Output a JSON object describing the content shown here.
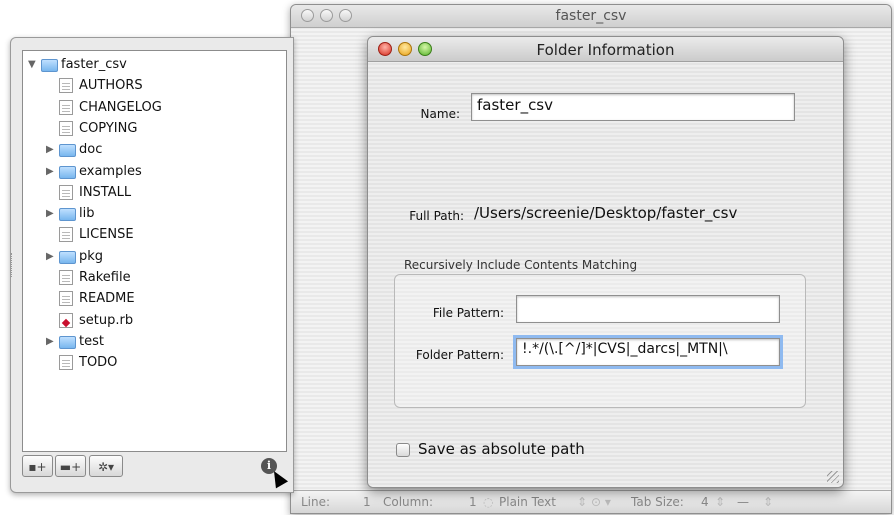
{
  "editor": {
    "title": "faster_csv",
    "status": {
      "line_label": "Line:",
      "line_value": "1",
      "column_label": "Column:",
      "column_value": "1",
      "language": "Plain Text",
      "tab_size_label": "Tab Size:",
      "tab_size_value": "4",
      "dash": "—"
    }
  },
  "drawer": {
    "tree": [
      {
        "label": "faster_csv",
        "kind": "folder",
        "expanded": true,
        "level": 0
      },
      {
        "label": "AUTHORS",
        "kind": "file",
        "level": 1
      },
      {
        "label": "CHANGELOG",
        "kind": "file",
        "level": 1
      },
      {
        "label": "COPYING",
        "kind": "file",
        "level": 1
      },
      {
        "label": "doc",
        "kind": "folder",
        "expanded": false,
        "level": 1
      },
      {
        "label": "examples",
        "kind": "folder",
        "expanded": false,
        "level": 1
      },
      {
        "label": "INSTALL",
        "kind": "file",
        "level": 1
      },
      {
        "label": "lib",
        "kind": "folder",
        "expanded": false,
        "level": 1
      },
      {
        "label": "LICENSE",
        "kind": "file",
        "level": 1
      },
      {
        "label": "pkg",
        "kind": "folder",
        "expanded": false,
        "level": 1
      },
      {
        "label": "Rakefile",
        "kind": "file",
        "level": 1
      },
      {
        "label": "README",
        "kind": "file",
        "level": 1
      },
      {
        "label": "setup.rb",
        "kind": "ruby",
        "level": 1
      },
      {
        "label": "test",
        "kind": "folder",
        "expanded": false,
        "level": 1
      },
      {
        "label": "TODO",
        "kind": "file",
        "level": 1
      }
    ],
    "toolbar": {
      "add_file_icon": "new-file-icon",
      "add_folder_icon": "new-folder-icon",
      "action_icon": "gear-icon",
      "info_icon": "info-icon",
      "info_glyph": "i"
    }
  },
  "dialog": {
    "title": "Folder Information",
    "name_label": "Name:",
    "name_value": "faster_csv",
    "full_path_label": "Full Path:",
    "full_path_value": "/Users/screenie/Desktop/faster_csv",
    "group_title": "Recursively Include Contents Matching",
    "file_pattern_label": "File Pattern:",
    "file_pattern_value": "",
    "folder_pattern_label": "Folder Pattern:",
    "folder_pattern_value": "!.*/(\\.[^/]*|CVS|_darcs|_MTN|\\",
    "absolute_path_label": "Save as absolute path"
  },
  "colors": {
    "folder_blue": "#78b6ee",
    "focus_ring": "#8fbaf0",
    "close_red": "#d62d1f",
    "minimize_yellow": "#e8a117",
    "zoom_green": "#55b22a"
  }
}
